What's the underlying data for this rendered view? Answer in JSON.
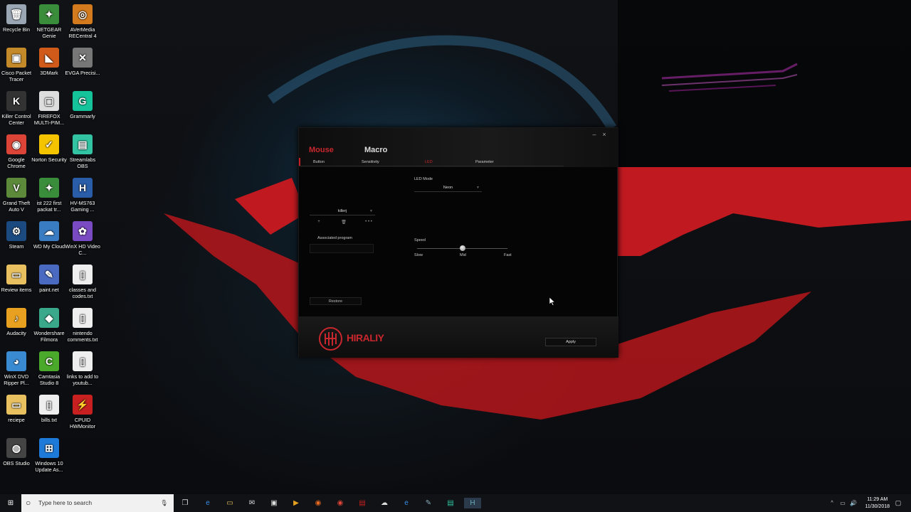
{
  "desktop": {
    "icons": [
      {
        "label": "Recycle Bin",
        "glyph": "🗑",
        "color": "#9aa6b4"
      },
      {
        "label": "NETGEAR Genie",
        "glyph": "✦",
        "color": "#3a8d3a"
      },
      {
        "label": "AVerMedia RECentral 4",
        "glyph": "◎",
        "color": "#d27a1d"
      },
      {
        "label": "Cisco Packet Tracer",
        "glyph": "▣",
        "color": "#c48a2a"
      },
      {
        "label": "3DMark",
        "glyph": "◣",
        "color": "#d05a1a"
      },
      {
        "label": "EVGA Precisi...",
        "glyph": "✕",
        "color": "#777"
      },
      {
        "label": "Killer Control Center",
        "glyph": "K",
        "color": "#333"
      },
      {
        "label": "FIREFOX MULTI-PIM...",
        "glyph": "▢",
        "color": "#ddd"
      },
      {
        "label": "Grammarly",
        "glyph": "G",
        "color": "#15c39a"
      },
      {
        "label": "Google Chrome",
        "glyph": "◉",
        "color": "#db4437"
      },
      {
        "label": "Norton Security",
        "glyph": "✓",
        "color": "#f5c400"
      },
      {
        "label": "Streamlabs OBS",
        "glyph": "▤",
        "color": "#31c3a2"
      },
      {
        "label": "Grand Theft Auto V",
        "glyph": "V",
        "color": "#5c8a3a"
      },
      {
        "label": "ist 222 first packat tr...",
        "glyph": "✦",
        "color": "#3a8d3a"
      },
      {
        "label": "HV-MS763 Gaming ...",
        "glyph": "H",
        "color": "#2a5da8"
      },
      {
        "label": "Steam",
        "glyph": "⚙",
        "color": "#1b4a80"
      },
      {
        "label": "WD My Cloud",
        "glyph": "☁",
        "color": "#3a7cc2"
      },
      {
        "label": "WinX HD Video C...",
        "glyph": "✿",
        "color": "#7a4ac2"
      },
      {
        "label": "Review items",
        "glyph": "▭",
        "color": "#e8c060"
      },
      {
        "label": "paint.net",
        "glyph": "✎",
        "color": "#4a6ac2"
      },
      {
        "label": "classes and codes.txt",
        "glyph": "▯",
        "color": "#eee"
      },
      {
        "label": "Audacity",
        "glyph": "♪",
        "color": "#e8a020"
      },
      {
        "label": "Wondershare Filmora",
        "glyph": "◆",
        "color": "#3aa88a"
      },
      {
        "label": "nintendo comments.txt",
        "glyph": "▯",
        "color": "#eee"
      },
      {
        "label": "WinX DVD Ripper Pl...",
        "glyph": "◕",
        "color": "#3a8ad2"
      },
      {
        "label": "Camtasia Studio 8",
        "glyph": "C",
        "color": "#4aa82a"
      },
      {
        "label": "links to add to youtub...",
        "glyph": "▯",
        "color": "#eee"
      },
      {
        "label": "reciepe",
        "glyph": "▭",
        "color": "#e8c060"
      },
      {
        "label": "bills.txt",
        "glyph": "▯",
        "color": "#eee"
      },
      {
        "label": "CPUID HWMonitor",
        "glyph": "⚡",
        "color": "#c82020"
      },
      {
        "label": "OBS Studio",
        "glyph": "◍",
        "color": "#444"
      },
      {
        "label": "Windows 10 Update As...",
        "glyph": "⊞",
        "color": "#1e7ad8"
      }
    ]
  },
  "app": {
    "main_tabs": [
      "Mouse",
      "Macro"
    ],
    "sub_tabs": [
      "Button",
      "Sensitivity",
      "LED",
      "Parameter"
    ],
    "led_mode_label": "LED Mode",
    "led_mode_value": "Neon",
    "profile_value": "killerj",
    "profile_add": "+",
    "profile_delete": "🗑",
    "profile_more": "• • •",
    "associated_program_label": "Associated program",
    "speed_label": "Speed",
    "speed_slow": "Slow",
    "speed_mid": "Mid",
    "speed_fast": "Fast",
    "speed_value_fraction": 0.5,
    "restore_label": "Restore",
    "apply_label": "Apply",
    "brand": "HIRALIY",
    "minimize": "–",
    "close": "×",
    "accent": "#c8272d"
  },
  "taskbar": {
    "search_placeholder": "Type here to search",
    "time": "11:29 AM",
    "date": "11/30/2018"
  }
}
